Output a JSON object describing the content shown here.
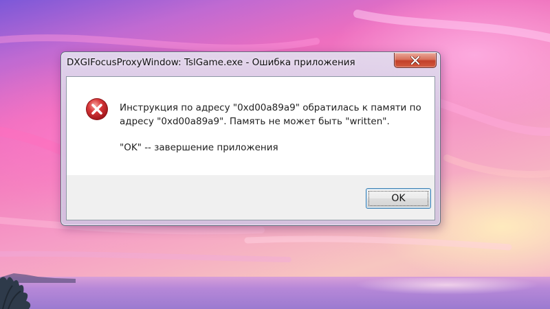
{
  "dialog": {
    "title": "DXGIFocusProxyWindow: TslGame.exe - Ошибка приложения",
    "message_line_1": "Инструкция по адресу \"0xd00a89a9\" обратилась к памяти по",
    "message_line_2": "адресу \"0xd00a89a9\". Память не может быть \"written\".",
    "message_line_3": "\"OK\" -- завершение приложения",
    "ok_label": "OK",
    "icon": "error-icon",
    "close_icon": "close-icon"
  },
  "colors": {
    "close_button": "#c7452f",
    "error_icon": "#c8252a",
    "focus_border": "#3c7fb1"
  }
}
